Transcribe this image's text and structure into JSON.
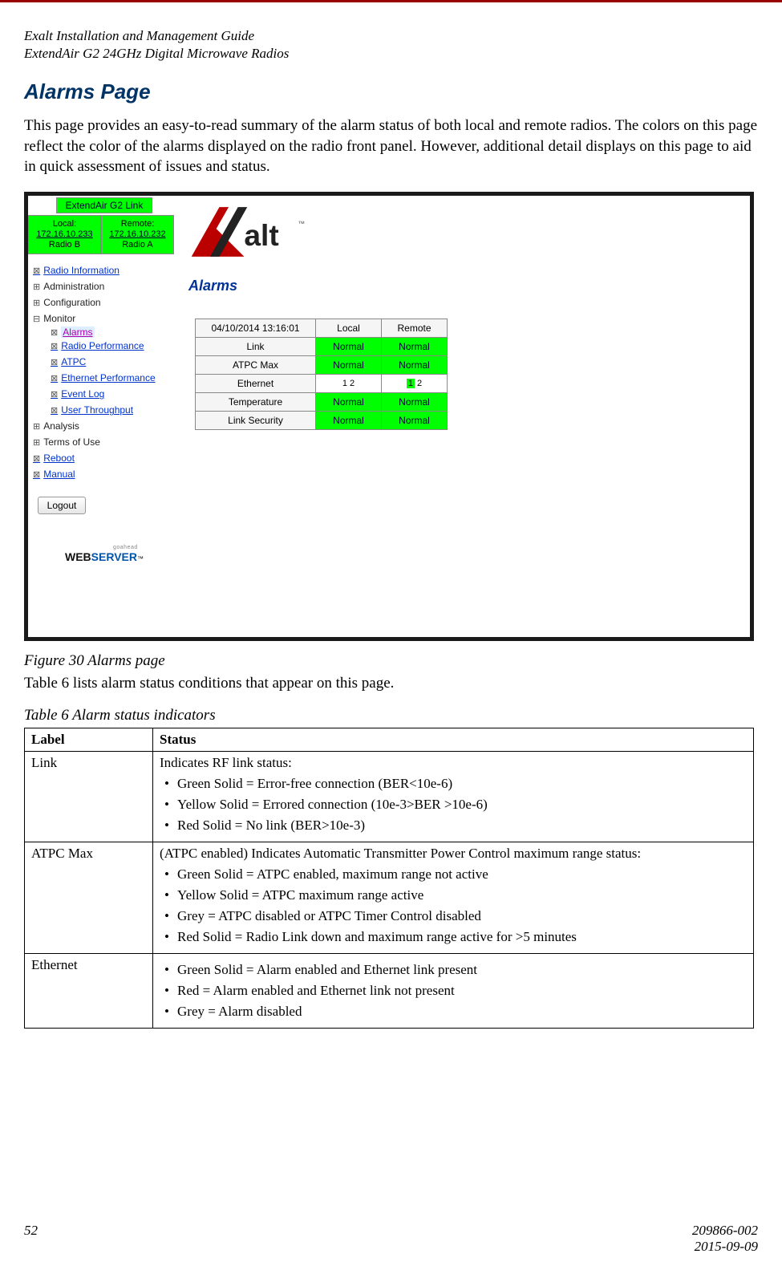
{
  "header": {
    "line1": "Exalt Installation and Management Guide",
    "line2": "ExtendAir G2 24GHz Digital Microwave Radios"
  },
  "title": "Alarms Page",
  "intro": "This page provides an easy-to-read summary of the alarm status of both local and remote radios. The colors on this page reflect the color of the alarms displayed on the radio front panel. However, additional detail displays on this page to aid in quick assessment of issues and status.",
  "figure": {
    "link_name": "ExtendAir G2 Link",
    "local": {
      "label": "Local:",
      "ip": "172.16.10.233",
      "radio": "Radio B"
    },
    "remote": {
      "label": "Remote:",
      "ip": "172.16.10.232",
      "radio": "Radio A"
    },
    "nav": {
      "radio_info": "Radio Information",
      "admin": "Administration",
      "config": "Configuration",
      "monitor": "Monitor",
      "alarms": "Alarms",
      "radio_perf": "Radio Performance",
      "atpc": "ATPC",
      "eth_perf": "Ethernet Performance",
      "event_log": "Event Log",
      "user_thru": "User Throughput",
      "analysis": "Analysis",
      "terms": "Terms of Use",
      "reboot": "Reboot",
      "manual": "Manual"
    },
    "logout": "Logout",
    "webserver": {
      "go": "goahead",
      "w": "WEB",
      "s": "SERVER"
    },
    "section_title": "Alarms",
    "alarm_table": {
      "ts": "04/10/2014 13:16:01",
      "hdr_local": "Local",
      "hdr_remote": "Remote",
      "rows": [
        {
          "label": "Link",
          "local": "Normal",
          "remote": "Normal",
          "type": "green"
        },
        {
          "label": "ATPC Max",
          "local": "Normal",
          "remote": "Normal",
          "type": "green"
        },
        {
          "label": "Ethernet",
          "local": "1 2",
          "remote": "1 2",
          "type": "eth"
        },
        {
          "label": "Temperature",
          "local": "Normal",
          "remote": "Normal",
          "type": "green"
        },
        {
          "label": "Link Security",
          "local": "Normal",
          "remote": "Normal",
          "type": "green"
        }
      ]
    },
    "caption": "Figure 30   Alarms page"
  },
  "after_fig": "Table 6 lists alarm status conditions that appear on this page.",
  "table6": {
    "caption": "Table 6  Alarm status indicators",
    "head": {
      "c1": "Label",
      "c2": "Status"
    },
    "rows": [
      {
        "label": "Link",
        "lead": "Indicates RF link status:",
        "items": [
          "Green Solid = Error-free connection (BER<10e-6)",
          "Yellow Solid = Errored connection (10e-3>BER >10e-6)",
          "Red Solid = No link (BER>10e-3)"
        ]
      },
      {
        "label": "ATPC Max",
        "lead": "(ATPC enabled) Indicates Automatic Transmitter Power Control maximum range status:",
        "items": [
          "Green Solid = ATPC enabled, maximum range not active",
          "Yellow Solid = ATPC maximum range active",
          "Grey = ATPC disabled or ATPC Timer Control disabled",
          "Red Solid = Radio Link down and maximum range active for >5 minutes"
        ]
      },
      {
        "label": "Ethernet",
        "lead": "",
        "items": [
          "Green Solid = Alarm enabled and Ethernet link present",
          "Red = Alarm enabled and Ethernet link not present",
          "Grey = Alarm disabled"
        ]
      }
    ]
  },
  "footer": {
    "page": "52",
    "docnum": "209866-002",
    "date": "2015-09-09"
  }
}
